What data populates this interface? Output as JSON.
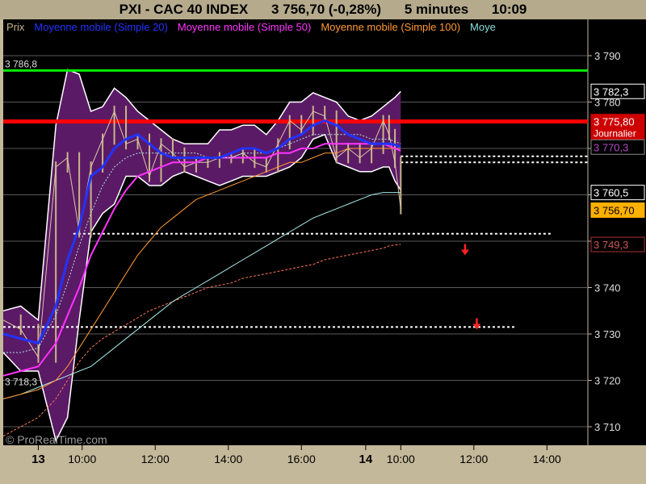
{
  "header": {
    "instrument": "PXI - CAC 40 INDEX",
    "last": "3 756,70 (-0,28%)",
    "interval": "5 minutes",
    "time": "10:09"
  },
  "legend": [
    {
      "label": "Prix",
      "color": "#c8b48a"
    },
    {
      "label": "Moyenne mobile (Simple 20)",
      "color": "#2233ff"
    },
    {
      "label": "Moyenne mobile (Simple 50)",
      "color": "#ff33ff"
    },
    {
      "label": "Moyenne mobile (Simple 100)",
      "color": "#ff9933"
    },
    {
      "label": "Moye",
      "color": "#88dddd"
    }
  ],
  "colors": {
    "band_fill": "#5b1a66",
    "resistance_green": "#00ee00",
    "resistance_red": "#ff0000",
    "ma20": "#2233ff",
    "ma50": "#ff33ff",
    "ma100": "#ff9933",
    "ma_cyan": "#a8e8e8",
    "price_candle": "#c8b48a"
  },
  "watermark": "© ProRealTime.com",
  "chart_data": {
    "type": "line",
    "ylim": [
      3706,
      3794
    ],
    "yticks": [
      {
        "value": 3790,
        "label": "3 790"
      },
      {
        "value": 3780,
        "label": "3 780"
      },
      {
        "value": 3770,
        "label": "3 770"
      },
      {
        "value": 3760,
        "label": "3 760"
      },
      {
        "value": 3750,
        "label": "3 750"
      },
      {
        "value": 3740,
        "label": "3 740"
      },
      {
        "value": 3730,
        "label": "3 730"
      },
      {
        "value": 3720,
        "label": "3 720"
      },
      {
        "value": 3710,
        "label": "3 710"
      }
    ],
    "xticks": [
      {
        "pos": 0.06,
        "label": "13",
        "bold": true
      },
      {
        "pos": 0.135,
        "label": "10:00"
      },
      {
        "pos": 0.26,
        "label": "12:00"
      },
      {
        "pos": 0.385,
        "label": "14:00"
      },
      {
        "pos": 0.51,
        "label": "16:00"
      },
      {
        "pos": 0.62,
        "label": "14",
        "bold": true
      },
      {
        "pos": 0.68,
        "label": "10:00"
      },
      {
        "pos": 0.805,
        "label": "12:00"
      },
      {
        "pos": 0.93,
        "label": "14:00"
      }
    ],
    "left_labels": [
      {
        "value": 3786.8,
        "label": "3 786,8"
      },
      {
        "value": 3718.3,
        "label": "3 718,3"
      }
    ],
    "right_labels": [
      {
        "value": 3782.3,
        "label": "3 782,3",
        "fg": "#ffffff",
        "bg": "#000000",
        "border": "#ffffff"
      },
      {
        "value": 3775.8,
        "label": "3 775,80",
        "fg": "#ffffff",
        "bg": "#cc0000",
        "border": "#cc0000",
        "extra": "Journalier"
      },
      {
        "value": 3770.3,
        "label": "3 770,3",
        "fg": "#b24bc6",
        "bg": "#000000",
        "border": "#888888"
      },
      {
        "value": 3760.5,
        "label": "3 760,5",
        "fg": "#ffffff",
        "bg": "#000000",
        "border": "#ffffff"
      },
      {
        "value": 3756.7,
        "label": "3 756,70",
        "fg": "#000000",
        "bg": "#ffb000",
        "border": "#ffb000"
      },
      {
        "value": 3749.3,
        "label": "3 749,3",
        "fg": "#cc5555",
        "bg": "#000000",
        "border": "#aa3333"
      }
    ],
    "hlines": [
      {
        "value": 3786.8,
        "color": "#00ee00",
        "width": 3,
        "style": "solid",
        "x0": 0.0,
        "x1": 1.0
      },
      {
        "value": 3775.8,
        "color": "#ff0000",
        "width": 5,
        "style": "solid",
        "x0": 0.0,
        "x1": 1.0
      },
      {
        "value": 3768.3,
        "color": "#ffffff",
        "width": 2,
        "style": "dash",
        "x0": 0.68,
        "x1": 1.0
      },
      {
        "value": 3767.0,
        "color": "#ffffff",
        "width": 2,
        "style": "dash",
        "x0": 0.68,
        "x1": 1.0
      },
      {
        "value": 3751.6,
        "color": "#ffffff",
        "width": 2,
        "style": "dash",
        "x0": 0.12,
        "x1": 0.94
      },
      {
        "value": 3731.5,
        "color": "#ffffff",
        "width": 2,
        "style": "dash",
        "x0": 0.0,
        "x1": 0.875
      }
    ],
    "arrows": [
      {
        "pos": 0.79,
        "value": 3748.0
      },
      {
        "pos": 0.81,
        "value": 3732.0
      }
    ],
    "x": [
      0.0,
      0.03,
      0.06,
      0.09,
      0.11,
      0.13,
      0.15,
      0.17,
      0.19,
      0.21,
      0.23,
      0.25,
      0.27,
      0.29,
      0.31,
      0.33,
      0.35,
      0.37,
      0.39,
      0.41,
      0.43,
      0.45,
      0.47,
      0.49,
      0.51,
      0.53,
      0.55,
      0.57,
      0.59,
      0.61,
      0.63,
      0.65,
      0.66,
      0.67,
      0.68
    ],
    "series": [
      {
        "key": "price",
        "values": [
          3733,
          3731,
          3725,
          3766,
          3768,
          3752,
          3766,
          3772,
          3778,
          3771,
          3772,
          3764,
          3771,
          3769,
          3766,
          3767,
          3767,
          3768,
          3768,
          3769,
          3767,
          3766,
          3771,
          3776,
          3774,
          3778,
          3777,
          3768,
          3770,
          3768,
          3770,
          3776,
          3773,
          3767,
          3757
        ]
      },
      {
        "key": "band_upper",
        "values": [
          3735,
          3736,
          3733,
          3775,
          3787,
          3786,
          3778,
          3779,
          3783,
          3781,
          3778,
          3776,
          3774,
          3772,
          3771,
          3771,
          3771,
          3774,
          3774,
          3775,
          3775,
          3773,
          3776,
          3780,
          3780,
          3782,
          3781,
          3780,
          3777,
          3776,
          3777,
          3779,
          3780,
          3781,
          3782.3
        ]
      },
      {
        "key": "band_lower",
        "values": [
          3726,
          3722,
          3722,
          3707,
          3712,
          3733,
          3752,
          3756,
          3758,
          3764,
          3764,
          3762,
          3762,
          3764,
          3765,
          3764,
          3763,
          3762,
          3763,
          3764,
          3764,
          3764,
          3765,
          3766,
          3768,
          3772,
          3773,
          3767,
          3766,
          3765,
          3765,
          3766,
          3766,
          3763,
          3761
        ]
      },
      {
        "key": "ma20",
        "values": [
          3730,
          3729,
          3728,
          3736,
          3746,
          3753,
          3764,
          3766,
          3770,
          3772,
          3773,
          3771,
          3769,
          3768,
          3768,
          3768,
          3768,
          3768,
          3769,
          3770,
          3770,
          3769,
          3770,
          3772,
          3773,
          3775,
          3776,
          3775,
          3773,
          3772,
          3771,
          3771,
          3771,
          3770.8,
          3770.3
        ]
      },
      {
        "key": "ma_cyan",
        "values": [
          3726,
          3726,
          3727,
          3734,
          3741,
          3749,
          3756,
          3762,
          3766,
          3768,
          3769,
          3769,
          3769,
          3769,
          3769,
          3769,
          3768,
          3768,
          3768,
          3769,
          3769,
          3769,
          3770,
          3771,
          3772,
          3773,
          3773,
          3773,
          3773,
          3773,
          3772,
          3772,
          3772,
          3771.5,
          3771
        ]
      },
      {
        "key": "ma50",
        "values": [
          3721,
          3722,
          3723,
          3728,
          3734,
          3740,
          3747,
          3752,
          3757,
          3761,
          3764,
          3765,
          3766,
          3767,
          3767,
          3767,
          3768,
          3768,
          3768,
          3768,
          3768,
          3768,
          3769,
          3769,
          3770,
          3770,
          3771,
          3771,
          3771,
          3771,
          3771,
          3771,
          3770.5,
          3770,
          3769.5
        ]
      },
      {
        "key": "ma100",
        "values": [
          3716,
          3717,
          3718,
          3720,
          3723,
          3727,
          3731,
          3735,
          3739,
          3743,
          3747,
          3750,
          3753,
          3755,
          3757,
          3759,
          3760,
          3761,
          3762,
          3763,
          3764,
          3765,
          3766,
          3767,
          3767,
          3768,
          3769,
          3769,
          3770,
          3770,
          3770,
          3770,
          3770,
          3770,
          3770
        ]
      },
      {
        "key": "ma_cyan_long",
        "values": [
          3716,
          3717,
          3718.5,
          3720,
          3721,
          3722,
          3723,
          3725,
          3727,
          3729,
          3731,
          3733,
          3735,
          3737,
          3738.5,
          3740,
          3741.5,
          3743,
          3744.5,
          3746,
          3747.5,
          3749,
          3750.5,
          3752,
          3753.5,
          3755,
          3756,
          3757,
          3758,
          3759,
          3760,
          3760.5,
          3760.5,
          3760.5,
          3760.5
        ]
      },
      {
        "key": "ma_dash",
        "values": [
          3708,
          3710,
          3712,
          3716,
          3720,
          3724,
          3727,
          3729,
          3730.5,
          3732,
          3733.5,
          3735,
          3736,
          3737,
          3738,
          3739,
          3740,
          3740.5,
          3741,
          3742,
          3742.5,
          3743,
          3743.5,
          3744,
          3744.5,
          3745,
          3746,
          3746.5,
          3747,
          3747.5,
          3748,
          3748.5,
          3749,
          3749.2,
          3749.3
        ]
      }
    ]
  }
}
